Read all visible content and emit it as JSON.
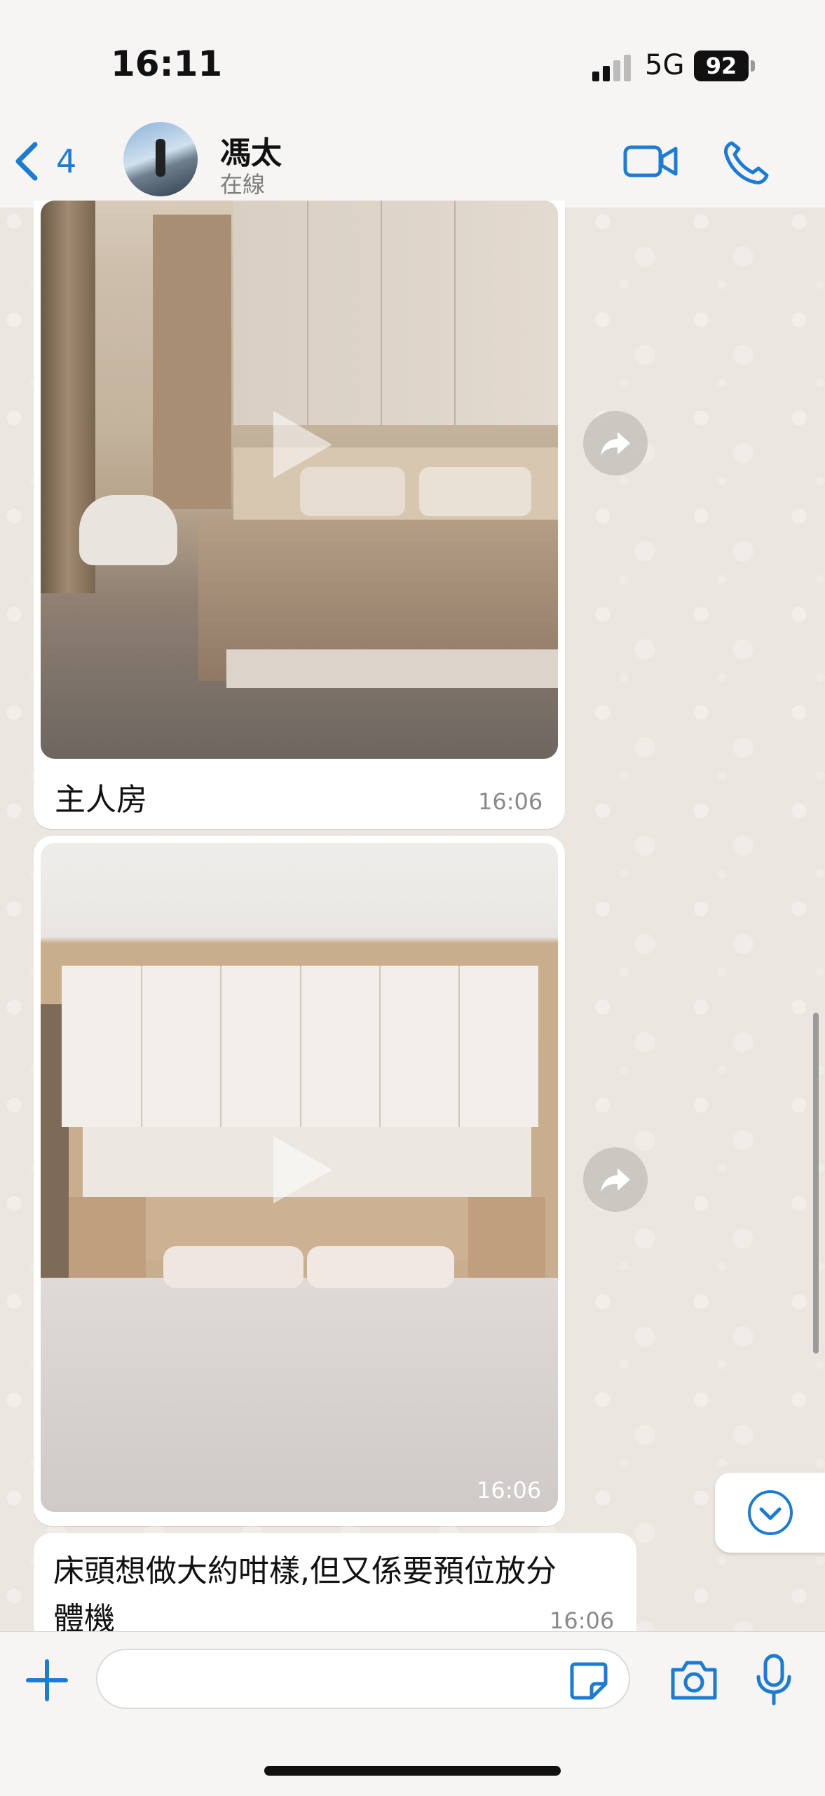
{
  "status_bar": {
    "time": "16:11",
    "network": "5G",
    "battery": "92"
  },
  "header": {
    "back_count": "4",
    "contact_name": "馮太",
    "contact_status": "在線"
  },
  "messages": [
    {
      "type": "video",
      "caption": "主人房",
      "time": "16:06"
    },
    {
      "type": "video",
      "caption": "",
      "time": "16:06"
    },
    {
      "type": "text",
      "text_line1": "床頭想做大約咁樣,但又係要預位放分",
      "text_line2": "體機",
      "time": "16:06"
    }
  ],
  "input": {
    "placeholder": ""
  },
  "icons": {
    "back": "chevron-left-icon",
    "video": "video-camera-icon",
    "call": "phone-icon",
    "forward": "forward-icon",
    "play": "play-icon",
    "scroll_down": "chevron-down-icon",
    "plus": "plus-icon",
    "sticker": "sticker-icon",
    "camera": "camera-icon",
    "mic": "microphone-icon"
  },
  "colors": {
    "accent": "#1d7ccf",
    "chat_background": "#ebe6df",
    "bubble": "#ffffff"
  }
}
